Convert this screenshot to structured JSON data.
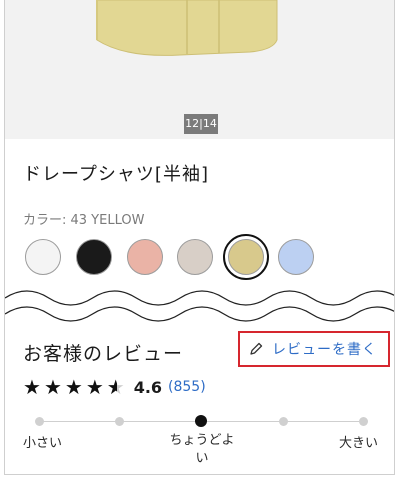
{
  "gallery": {
    "current": "12",
    "total": "14"
  },
  "product": {
    "title": "ドレープシャツ[半袖]",
    "color_label": "カラー: 43 YELLOW"
  },
  "swatches": [
    {
      "color": "#f4f4f4"
    },
    {
      "color": "#1a1a1a"
    },
    {
      "color": "#eab3a6"
    },
    {
      "color": "#d8cfc7"
    },
    {
      "color": "#d8c98c",
      "selected": true
    },
    {
      "color": "#bcd0f2"
    }
  ],
  "reviews": {
    "title": "お客様のレビュー",
    "write_label": "レビューを書く",
    "stars": [
      "★",
      "★",
      "★",
      "★",
      "★"
    ],
    "rating": "4.6",
    "count": "(855)"
  },
  "fit": {
    "labels": {
      "small": "小さい",
      "just": "ちょうどよい",
      "large": "大きい"
    },
    "selected_index": 2,
    "positions": 5
  }
}
